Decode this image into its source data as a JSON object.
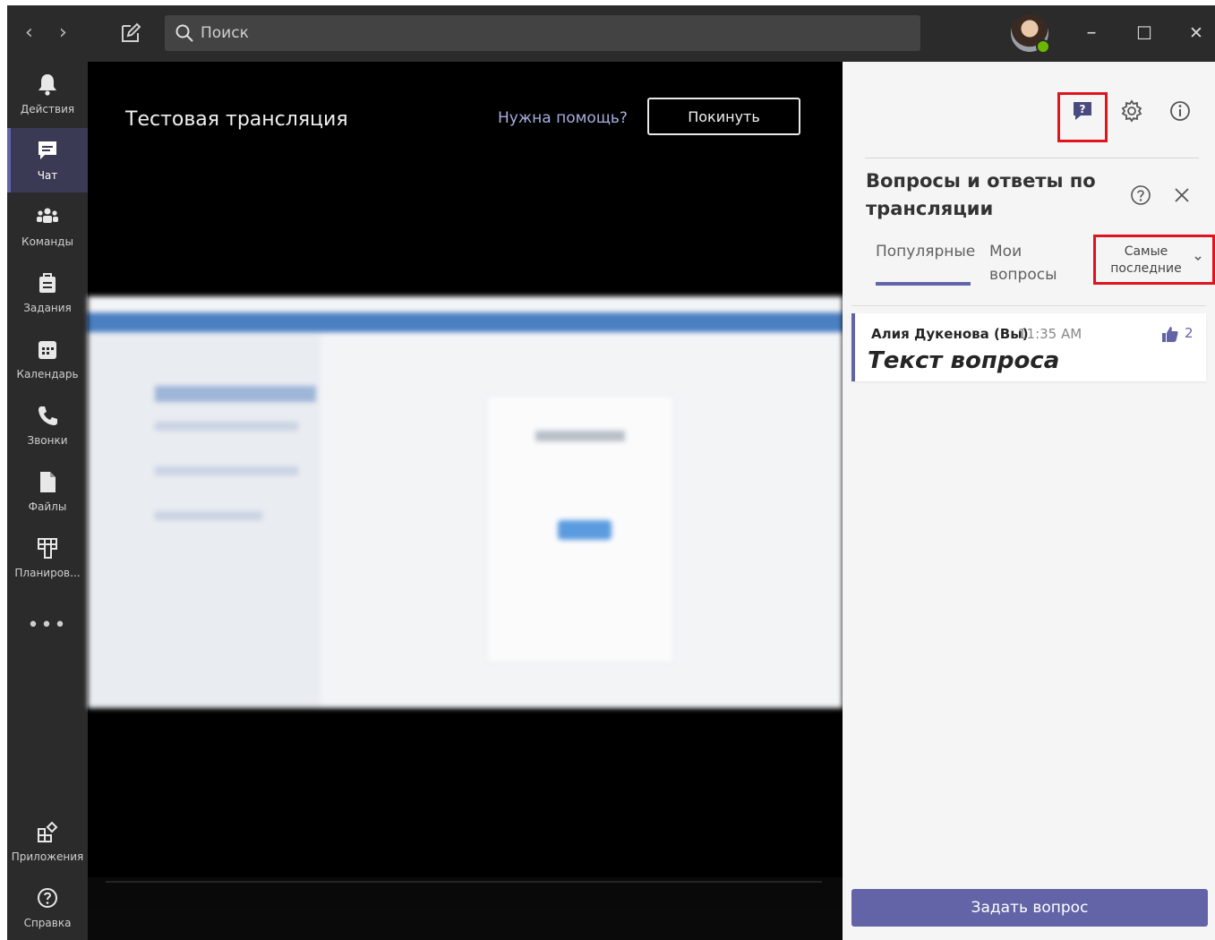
{
  "titlebar": {
    "back": "‹",
    "forward": "›",
    "search_placeholder": "Поиск",
    "minimize": "–",
    "maximize": "☐",
    "close": "✕"
  },
  "rail": {
    "items": [
      {
        "label": "Действия",
        "icon": "bell-icon"
      },
      {
        "label": "Чат",
        "icon": "chat-icon"
      },
      {
        "label": "Команды",
        "icon": "teams-icon"
      },
      {
        "label": "Задания",
        "icon": "assignments-icon"
      },
      {
        "label": "Календарь",
        "icon": "calendar-icon"
      },
      {
        "label": "Звонки",
        "icon": "phone-icon"
      },
      {
        "label": "Файлы",
        "icon": "file-icon"
      },
      {
        "label": "Планиров...",
        "icon": "planner-icon"
      }
    ],
    "more": "•••",
    "apps": "Приложения",
    "help": "Справка"
  },
  "stage": {
    "title": "Тестовая трансляция",
    "help_link": "Нужна помощь?",
    "leave_button": "Покинуть"
  },
  "qa": {
    "title": "Вопросы и ответы по трансляции",
    "tabs": [
      "Популярные",
      "Мои вопросы"
    ],
    "sort": "Самые последние",
    "questions": [
      {
        "author": "Алия Дукенова (Вы)",
        "time": "11:35 AM",
        "text": "Текст вопроса",
        "likes": "2"
      }
    ],
    "ask_button": "Задать вопрос"
  },
  "colors": {
    "accent": "#6264a7",
    "highlight": "#e0141e",
    "dark": "#2b2b2b"
  }
}
